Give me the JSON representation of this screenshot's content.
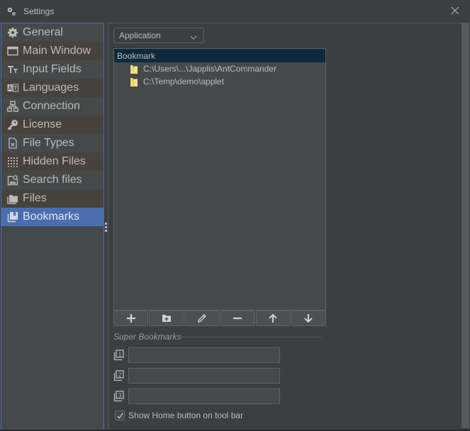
{
  "window": {
    "title": "Settings",
    "app_icon": "gears-icon",
    "close_icon": "close-icon"
  },
  "sidebar": {
    "selected": "Bookmarks",
    "items": [
      {
        "label": "General",
        "icon": "gear-icon"
      },
      {
        "label": "Main Window",
        "icon": "window-icon"
      },
      {
        "label": "Input Fields",
        "icon": "text-size-icon"
      },
      {
        "label": "Languages",
        "icon": "translate-icon"
      },
      {
        "label": "Connection",
        "icon": "network-icon"
      },
      {
        "label": "License",
        "icon": "key-icon"
      },
      {
        "label": "File Types",
        "icon": "file-x-icon"
      },
      {
        "label": "Hidden Files",
        "icon": "dotted-grid-icon"
      },
      {
        "label": "Search files",
        "icon": "image-search-icon"
      },
      {
        "label": "Files",
        "icon": "folders-icon"
      },
      {
        "label": "Bookmarks",
        "icon": "bookmarks-icon"
      }
    ]
  },
  "content": {
    "scope_select": {
      "value": "Application"
    },
    "tree": {
      "root": "Bookmark",
      "nodes": [
        {
          "label": "C:\\Users\\...\\Japplis\\AntCommander",
          "icon": "folder-icon"
        },
        {
          "label": "C:\\Temp\\demo\\applet",
          "icon": "folder-icon"
        }
      ]
    },
    "toolbar": [
      {
        "name": "add-bookmark-button",
        "icon": "plus-icon"
      },
      {
        "name": "add-folder-button",
        "icon": "folder-plus-icon"
      },
      {
        "name": "edit-bookmark-button",
        "icon": "pencil-icon"
      },
      {
        "name": "remove-bookmark-button",
        "icon": "minus-icon"
      },
      {
        "name": "move-up-button",
        "icon": "arrow-up-icon"
      },
      {
        "name": "move-down-button",
        "icon": "arrow-down-icon"
      }
    ],
    "super_bookmarks": {
      "title": "Super Bookmarks",
      "fields": [
        {
          "index": "1",
          "value": ""
        },
        {
          "index": "2",
          "value": ""
        },
        {
          "index": "3",
          "value": ""
        }
      ]
    },
    "show_home_checkbox": {
      "label": "Show Home button on tool bar",
      "checked": true
    }
  },
  "colors": {
    "background": "#3c3f41",
    "selection": "#4b6eaf",
    "tree_root_selection": "#0d293e",
    "folder": "#f0d56b"
  }
}
